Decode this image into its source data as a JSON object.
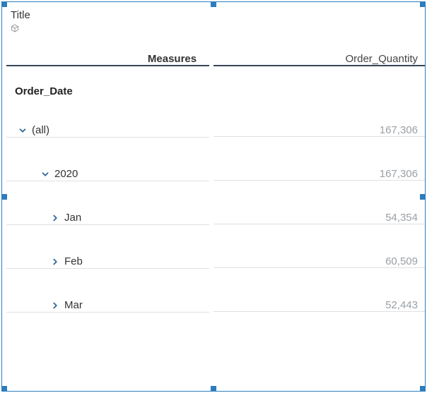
{
  "header": {
    "title": "Title",
    "icon": "cube-icon"
  },
  "columns": {
    "measures_label": "Measures",
    "metric_0": "Order_Quantity"
  },
  "dimension": {
    "label": "Order_Date"
  },
  "rows": [
    {
      "label": "(all)",
      "value": "167,306",
      "indent": 0,
      "expanded": true
    },
    {
      "label": "2020",
      "value": "167,306",
      "indent": 1,
      "expanded": true
    },
    {
      "label": "Jan",
      "value": "54,354",
      "indent": 2,
      "expanded": false
    },
    {
      "label": "Feb",
      "value": "60,509",
      "indent": 2,
      "expanded": false
    },
    {
      "label": "Mar",
      "value": "52,443",
      "indent": 2,
      "expanded": false
    }
  ],
  "chart_data": {
    "type": "table",
    "title": "Title",
    "dimension": "Order_Date",
    "measure": "Order_Quantity",
    "rows": [
      {
        "path": [
          "(all)"
        ],
        "Order_Quantity": 167306
      },
      {
        "path": [
          "(all)",
          "2020"
        ],
        "Order_Quantity": 167306
      },
      {
        "path": [
          "(all)",
          "2020",
          "Jan"
        ],
        "Order_Quantity": 54354
      },
      {
        "path": [
          "(all)",
          "2020",
          "Feb"
        ],
        "Order_Quantity": 60509
      },
      {
        "path": [
          "(all)",
          "2020",
          "Mar"
        ],
        "Order_Quantity": 52443
      }
    ]
  }
}
